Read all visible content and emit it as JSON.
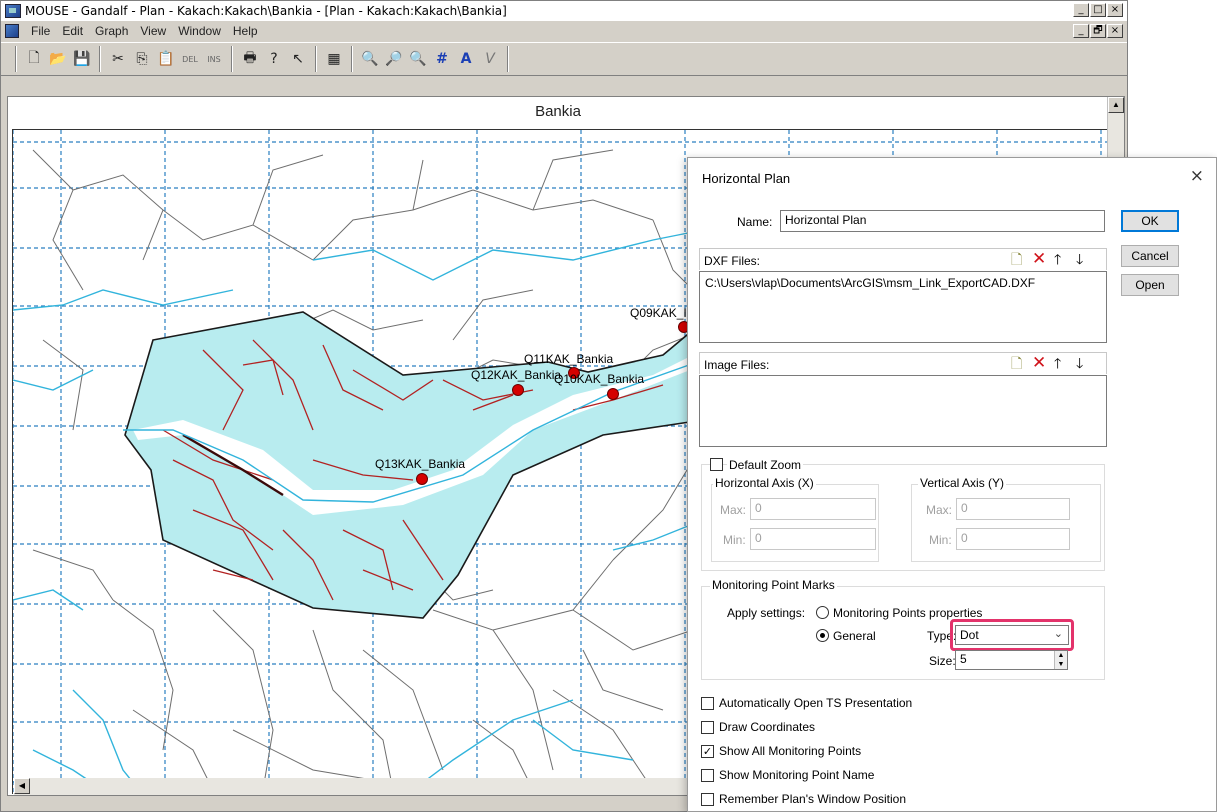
{
  "window": {
    "title": "MOUSE - Gandalf - Plan - Kakach:Kakach\\Bankia - [Plan - Kakach:Kakach\\Bankia]",
    "caption_top": [
      "_",
      "□",
      "×"
    ],
    "caption_mdi": [
      "_",
      "🗗",
      "×"
    ]
  },
  "menu": [
    "File",
    "Edit",
    "Graph",
    "View",
    "Window",
    "Help"
  ],
  "toolbar": {
    "del_label": "DEL",
    "ins_label": "INS",
    "text_a": "A",
    "check_v": "V"
  },
  "plot": {
    "title": "Bankia",
    "colors": {
      "catchment": "#b8ecef",
      "river": "#32b4dc",
      "network": "#b22222",
      "roads": "#6e6e6e",
      "grid": "#2a7fc0",
      "dot": "#d50000"
    },
    "points": [
      {
        "name": "Q09KAK_I"
      },
      {
        "name": "Q11KAK_Bankia"
      },
      {
        "name": "Q12KAK_Bankia"
      },
      {
        "name": "Q10KAK_Bankia"
      },
      {
        "name": "Q13KAK_Bankia"
      }
    ]
  },
  "dialog": {
    "title": "Horizontal Plan",
    "close": "×",
    "name_label": "Name:",
    "name_value": "Horizontal Plan",
    "ok": "OK",
    "cancel": "Cancel",
    "open": "Open",
    "dxf_label": "DXF Files:",
    "dxf_items": [
      "C:\\Users\\vlap\\Documents\\ArcGIS\\msm_Link_ExportCAD.DXF"
    ],
    "image_label": "Image Files:",
    "default_zoom": "Default Zoom",
    "haxis": "Horizontal Axis (X)",
    "vaxis": "Vertical Axis (Y)",
    "max_label": "Max:",
    "min_label": "Min:",
    "hmax": "0",
    "hmin": "0",
    "vmax": "0",
    "vmin": "0",
    "mpm_title": "Monitoring Point Marks",
    "apply_label": "Apply settings:",
    "opt_props": "Monitoring Points properties",
    "opt_general": "General",
    "type_label": "Type:",
    "type_value": "Dot",
    "size_label": "Size:",
    "size_value": "5",
    "checks": [
      {
        "label": "Automatically Open TS Presentation",
        "checked": false
      },
      {
        "label": "Draw Coordinates",
        "checked": false
      },
      {
        "label": "Show All Monitoring Points",
        "checked": true
      },
      {
        "label": "Show Monitoring Point Name",
        "checked": false
      },
      {
        "label": "Remember Plan's Window Position",
        "checked": false
      }
    ]
  }
}
